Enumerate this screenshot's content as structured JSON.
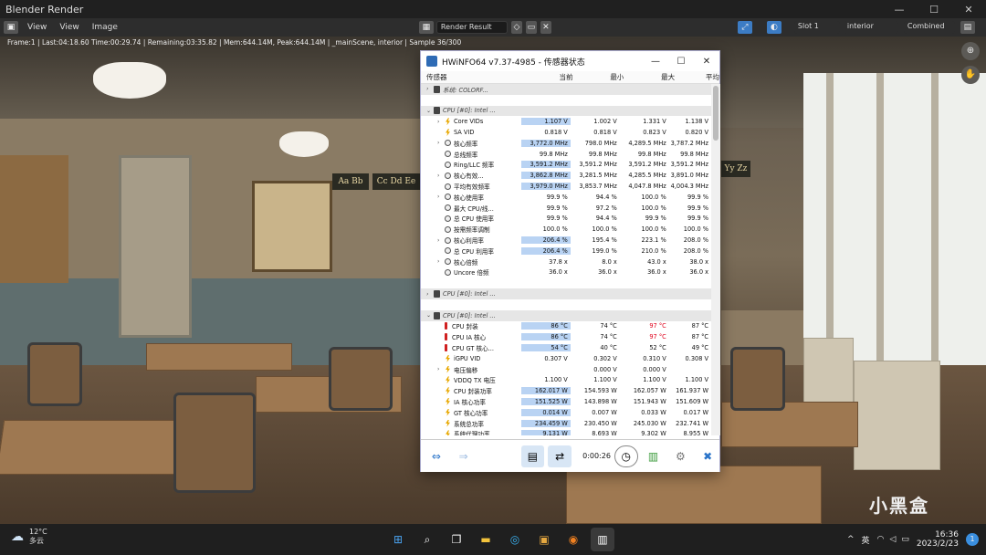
{
  "window": {
    "title": "Blender Render"
  },
  "menu": {
    "view1": "View",
    "view2": "View",
    "image": "Image",
    "image_name": "Render Result",
    "slot": "Slot 1",
    "layer": "interior",
    "pass": "Combined"
  },
  "render_status": "Frame:1 | Last:04:18.60 Time:00:29.74 | Remaining:03:35.82 | Mem:644.14M, Peak:644.14M | _mainScene, interior | Sample 36/300",
  "scene_text": {
    "abc1": "Aa Bb",
    "abc2": "Cc Dd Ee",
    "xyz": "Yy Zz"
  },
  "hwinfo": {
    "title": "HWiNFO64 v7.37-4985 - 传感器状态",
    "headers": {
      "sensor": "传感器",
      "current": "当前",
      "min": "最小",
      "max": "最大",
      "avg": "平均"
    },
    "timer": "0:00:26",
    "rows": [
      {
        "name": "系统: COLORF...",
        "type": "grp",
        "icon": "chip",
        "exp": ">"
      },
      {
        "type": "blank"
      },
      {
        "name": "CPU [#0]: Intel ...",
        "type": "grp",
        "icon": "chip",
        "exp": "v"
      },
      {
        "name": "Core VIDs",
        "icon": "bolt",
        "exp": ">",
        "ind": 1,
        "cur": "1.107 V",
        "min": "1.002 V",
        "max": "1.331 V",
        "avg": "1.138 V",
        "hl": true
      },
      {
        "name": "SA VID",
        "icon": "bolt",
        "cur": "0.818 V",
        "min": "0.818 V",
        "max": "0.823 V",
        "avg": "0.820 V"
      },
      {
        "name": "核心频率",
        "icon": "circ",
        "exp": ">",
        "ind": 1,
        "cur": "3,772.0 MHz",
        "min": "798.0 MHz",
        "max": "4,289.5 MHz",
        "avg": "3,787.2 MHz",
        "hl": true
      },
      {
        "name": "总线频率",
        "icon": "circ",
        "cur": "99.8 MHz",
        "min": "99.8 MHz",
        "max": "99.8 MHz",
        "avg": "99.8 MHz"
      },
      {
        "name": "Ring/LLC 频率",
        "icon": "circ",
        "cur": "3,591.2 MHz",
        "min": "3,591.2 MHz",
        "max": "3,591.2 MHz",
        "avg": "3,591.2 MHz",
        "hl": true
      },
      {
        "name": "核心有效...",
        "icon": "circ",
        "exp": ">",
        "ind": 1,
        "cur": "3,862.8 MHz",
        "min": "3,281.5 MHz",
        "max": "4,285.5 MHz",
        "avg": "3,891.0 MHz",
        "hl": true
      },
      {
        "name": "平均有效频率",
        "icon": "circ",
        "cur": "3,979.0 MHz",
        "min": "3,853.7 MHz",
        "max": "4,047.8 MHz",
        "avg": "4,004.3 MHz",
        "hl": true
      },
      {
        "name": "核心使用率",
        "icon": "circ",
        "exp": ">",
        "ind": 1,
        "cur": "99.9 %",
        "min": "94.4 %",
        "max": "100.0 %",
        "avg": "99.9 %"
      },
      {
        "name": "最大 CPU/线...",
        "icon": "circ",
        "cur": "99.9 %",
        "min": "97.2 %",
        "max": "100.0 %",
        "avg": "99.9 %"
      },
      {
        "name": "总 CPU 使用率",
        "icon": "circ",
        "cur": "99.9 %",
        "min": "94.4 %",
        "max": "99.9 %",
        "avg": "99.9 %"
      },
      {
        "name": "按需频率调制",
        "icon": "circ",
        "cur": "100.0 %",
        "min": "100.0 %",
        "max": "100.0 %",
        "avg": "100.0 %"
      },
      {
        "name": "核心利用率",
        "icon": "circ",
        "exp": ">",
        "ind": 1,
        "cur": "206.4 %",
        "min": "195.4 %",
        "max": "223.1 %",
        "avg": "208.0 %",
        "hl": true
      },
      {
        "name": "总 CPU 利用率",
        "icon": "circ",
        "cur": "206.4 %",
        "min": "199.0 %",
        "max": "210.0 %",
        "avg": "208.0 %",
        "hl": true
      },
      {
        "name": "核心倍频",
        "icon": "circ",
        "exp": ">",
        "ind": 1,
        "cur": "37.8 x",
        "min": "8.0 x",
        "max": "43.0 x",
        "avg": "38.0 x"
      },
      {
        "name": "Uncore 倍频",
        "icon": "circ",
        "cur": "36.0 x",
        "min": "36.0 x",
        "max": "36.0 x",
        "avg": "36.0 x"
      },
      {
        "type": "blank"
      },
      {
        "name": "CPU [#0]: Intel ...",
        "type": "grp",
        "icon": "chip",
        "exp": ">"
      },
      {
        "type": "blank"
      },
      {
        "name": "CPU [#0]: Intel ...",
        "type": "grp",
        "icon": "chip",
        "exp": "v"
      },
      {
        "name": "CPU 封装",
        "icon": "therm",
        "cur": "86 °C",
        "min": "74 °C",
        "max": "97 °C",
        "avg": "87 °C",
        "hl": true,
        "red": true
      },
      {
        "name": "CPU IA 核心",
        "icon": "therm",
        "cur": "86 °C",
        "min": "74 °C",
        "max": "97 °C",
        "avg": "87 °C",
        "hl": true,
        "red": true
      },
      {
        "name": "CPU GT 核心...",
        "icon": "therm",
        "cur": "54 °C",
        "min": "40 °C",
        "max": "52 °C",
        "avg": "49 °C",
        "hl": true
      },
      {
        "name": "iGPU VID",
        "icon": "bolt",
        "cur": "0.307 V",
        "min": "0.302 V",
        "max": "0.310 V",
        "avg": "0.308 V"
      },
      {
        "name": "电压偏移",
        "icon": "bolt",
        "exp": ">",
        "ind": 1,
        "cur": "",
        "min": "0.000 V",
        "max": "0.000 V",
        "avg": ""
      },
      {
        "name": "VDDQ TX 电压",
        "icon": "bolt",
        "cur": "1.100 V",
        "min": "1.100 V",
        "max": "1.100 V",
        "avg": "1.100 V"
      },
      {
        "name": "CPU 封装功率",
        "icon": "bolt",
        "cur": "162.017 W",
        "min": "154.593 W",
        "max": "162.057 W",
        "avg": "161.937 W",
        "hl": true
      },
      {
        "name": "IA 核心功率",
        "icon": "bolt",
        "cur": "151.525 W",
        "min": "143.898 W",
        "max": "151.943 W",
        "avg": "151.609 W",
        "hl": true
      },
      {
        "name": "GT 核心功率",
        "icon": "bolt",
        "cur": "0.014 W",
        "min": "0.007 W",
        "max": "0.033 W",
        "avg": "0.017 W",
        "hl": true
      },
      {
        "name": "系统总功率",
        "icon": "bolt",
        "cur": "234.459 W",
        "min": "230.450 W",
        "max": "245.030 W",
        "avg": "232.741 W",
        "hl": true
      },
      {
        "name": "系统代理功率",
        "icon": "bolt",
        "cur": "9.131 W",
        "min": "8.693 W",
        "max": "9.302 W",
        "avg": "8.955 W",
        "hl": true
      }
    ]
  },
  "taskbar": {
    "temp": "12°C",
    "weather": "多云",
    "lang": "英",
    "time": "16:36",
    "date": "2023/2/23",
    "notif": "1"
  },
  "watermark": "小黑盒",
  "colors": {
    "highlight": "#b9d3f3",
    "red": "#e0001b",
    "blender_bg": "#2d2d2d"
  }
}
